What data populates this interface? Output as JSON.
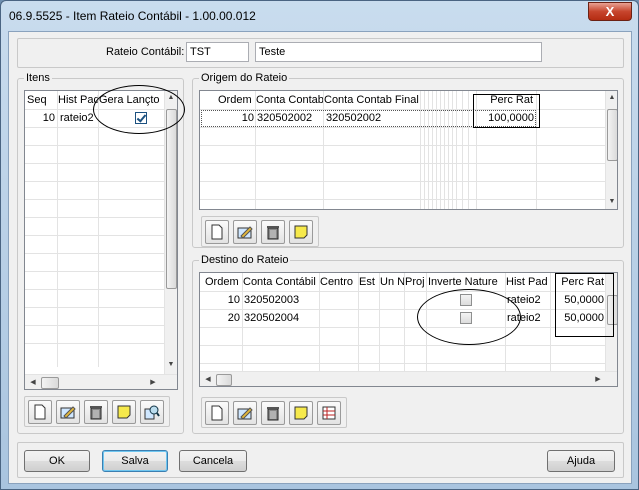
{
  "window": {
    "title": "06.9.5525 - Item Rateio Contábil - 1.00.00.012",
    "close_label": "X"
  },
  "header": {
    "rateio_label": "Rateio Contábil:",
    "rateio_code": "TST",
    "rateio_desc": "Teste"
  },
  "itens": {
    "title": "Itens",
    "columns": [
      "Seq",
      "Hist Pad",
      "Gera Lançto"
    ],
    "rows": [
      {
        "seq": "10",
        "hist": "rateio2",
        "gera": true
      }
    ]
  },
  "origem": {
    "title": "Origem do Rateio",
    "columns": [
      "Ordem",
      "Conta Contab",
      "Conta Contab Final",
      "Perc Rat"
    ],
    "rows": [
      {
        "ordem": "10",
        "conta": "320502002",
        "conta_final": "320502002",
        "perc": "100,0000"
      }
    ]
  },
  "destino": {
    "title": "Destino do Rateio",
    "columns": [
      "Ordem",
      "Conta Contábil",
      "Centro",
      "Est",
      "Un N",
      "Proj",
      "Inverte Nature",
      "Hist Pad",
      "Perc Rat"
    ],
    "rows": [
      {
        "ordem": "10",
        "conta": "320502003",
        "inverte": false,
        "hist": "rateio2",
        "perc": "50,0000"
      },
      {
        "ordem": "20",
        "conta": "320502004",
        "inverte": false,
        "hist": "rateio2",
        "perc": "50,0000"
      }
    ]
  },
  "toolbar_icons": {
    "itens": [
      "new-icon",
      "edit-icon",
      "delete-icon",
      "note-icon",
      "search-icon"
    ],
    "origem": [
      "new-icon",
      "edit-icon",
      "delete-icon",
      "note-icon"
    ],
    "destino": [
      "new-icon",
      "edit-icon",
      "delete-icon",
      "note-icon",
      "grid-icon"
    ]
  },
  "buttons": {
    "ok": "OK",
    "salva": "Salva",
    "cancela": "Cancela",
    "ajuda": "Ajuda"
  }
}
